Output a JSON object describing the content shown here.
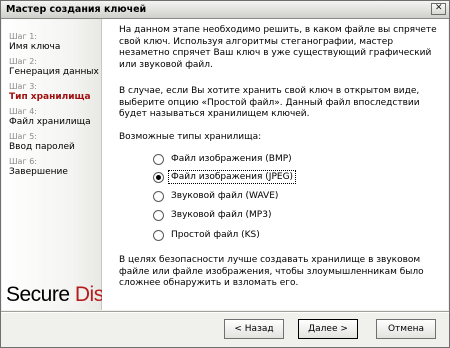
{
  "window": {
    "title": "Мастер создания ключей",
    "close_glyph": "✕"
  },
  "sidebar": {
    "steps": [
      {
        "num": "Шаг 1:",
        "label": "Имя ключа"
      },
      {
        "num": "Шаг 2:",
        "label": "Генерация данных"
      },
      {
        "num": "Шаг 3:",
        "label": "Тип хранилища",
        "active": true
      },
      {
        "num": "Шаг 4:",
        "label": "Файл хранилища"
      },
      {
        "num": "Шаг 5:",
        "label": "Ввод паролей"
      },
      {
        "num": "Шаг 6:",
        "label": "Завершение"
      }
    ],
    "logo": {
      "word1": "Secure",
      "word2": "Disk"
    }
  },
  "content": {
    "para1": "На данном этапе необходимо решить, в каком файле вы спрячете свой ключ. Используя алгоритмы стеганографии, мастер незаметно спрячет Ваш ключ в уже существующий графический или звуковой файл.",
    "para2": "В случае, если Вы хотите хранить свой ключ в открытом виде, выберите опцию «Простой файл». Данный файл впоследствии будет называться хранилищем ключей.",
    "options_heading": "Возможные типы хранилища:",
    "options": [
      {
        "label": "Файл изображения (BMP)",
        "checked": false
      },
      {
        "label": "Файл изображения (JPEG)",
        "checked": true
      },
      {
        "label": "Звуковой файл (WAVE)",
        "checked": false
      },
      {
        "label": "Звуковой файл (MP3)",
        "checked": false
      },
      {
        "label": "Простой файл (KS)",
        "checked": false
      }
    ],
    "note": "В целях безопасности лучше создавать хранилище в звуковом файле или файле изображения, чтобы злоумышленникам было сложнее обнаружить и взломать его."
  },
  "buttons": {
    "back": "< Назад",
    "next": "Далее >",
    "cancel": "Отмена"
  }
}
